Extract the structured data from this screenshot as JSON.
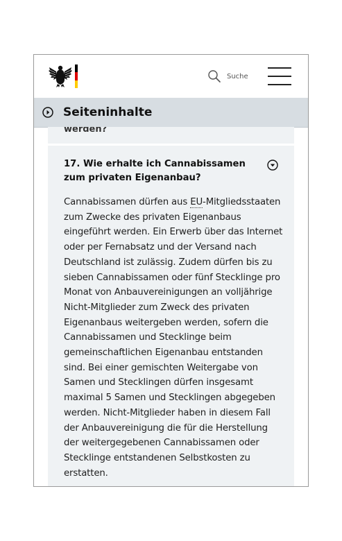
{
  "header": {
    "flag_colors": [
      "#000000",
      "#dd0000",
      "#ffcc00"
    ],
    "search_label": "Suche",
    "icons": [
      "eagle-icon",
      "search-icon",
      "hamburger-menu-icon"
    ]
  },
  "subnav": {
    "label": "Seiteninhalte",
    "icon": "chevron-right-circle-icon"
  },
  "previous_item": {
    "partial_text": "werden?"
  },
  "faq_item": {
    "title": "17. Wie erhalte ich Cannabissamen zum privaten Eigenanbau?",
    "toggle_icon": "chevron-down-circle-icon",
    "answer_lines": [
      {
        "pre": "Cannabissamen dürfen aus ",
        "abbr": "EU",
        "post": "-Mitgliedsstaaten"
      },
      {
        "text": "zum Zwecke des privaten Eigenanbaus"
      },
      {
        "text": "eingeführt werden. Ein Erwerb über das Internet"
      },
      {
        "text": "oder per Fernabsatz und der Versand nach"
      },
      {
        "text": "Deutschland ist zulässig. Zudem dürfen bis zu"
      },
      {
        "text": "sieben Cannabissamen oder fünf Stecklinge pro"
      },
      {
        "text": "Monat von Anbauvereinigungen an volljährige"
      },
      {
        "text": "Nicht-Mitglieder zum Zweck des privaten"
      },
      {
        "text": "Eigenanbaus weitergeben werden, sofern die"
      },
      {
        "text": "Cannabissamen und Stecklinge beim"
      },
      {
        "text": "gemeinschaftlichen Eigenanbau entstanden"
      },
      {
        "text": "sind. Bei einer gemischten Weitergabe von"
      },
      {
        "text": "Samen und Stecklingen dürfen insgesamt"
      },
      {
        "text": "maximal 5 Samen und Stecklingen abgegeben"
      },
      {
        "text": "werden. Nicht-Mitglieder haben in diesem Fall"
      },
      {
        "text": "der Anbauvereinigung die für die Herstellung"
      },
      {
        "text": "der weitergegebenen Cannabissamen oder"
      },
      {
        "text": "Stecklinge entstandenen Selbstkosten zu"
      },
      {
        "text": "erstatten."
      }
    ]
  },
  "colors": {
    "subnav_bg": "#d7dde2",
    "card_bg": "#eff2f4"
  }
}
